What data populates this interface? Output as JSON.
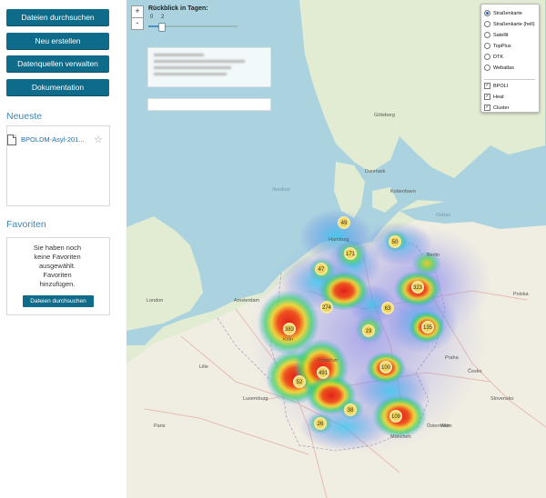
{
  "sidebar": {
    "buttons": [
      "Dateien durchsuchen",
      "Neu erstellen",
      "Datenquellen verwalten",
      "Dokumentation"
    ],
    "recent": {
      "title": "Neueste",
      "items": [
        {
          "label": "BPOLDM-Asyl-201..."
        }
      ]
    },
    "favorites": {
      "title": "Favoriten",
      "empty_text": "Sie haben noch keine Favoriten ausgewählt. Favoriten hinzufügen.",
      "button": "Dateien durchsuchen"
    }
  },
  "map": {
    "zoom_in": "+",
    "zoom_out": "-",
    "slider": {
      "title": "Rückblick in Tagen:",
      "min_label": "0",
      "max_label": "2",
      "value_fraction": 0.14
    },
    "layers": {
      "base": [
        {
          "label": "Straßenkarte",
          "selected": true
        },
        {
          "label": "Straßenkarte (hell)",
          "selected": false
        },
        {
          "label": "Satellit",
          "selected": false
        },
        {
          "label": "TopPlus",
          "selected": false
        },
        {
          "label": "DTK",
          "selected": false
        },
        {
          "label": "Webatlas",
          "selected": false
        }
      ],
      "overlays": [
        {
          "label": "BPOLI",
          "checked": true
        },
        {
          "label": "Heat",
          "checked": true
        },
        {
          "label": "Cluster",
          "checked": true
        }
      ]
    },
    "clusters": [
      "49",
      "50",
      "171",
      "47",
      "323",
      "274",
      "63",
      "19",
      "135",
      "383",
      "491",
      "52",
      "100",
      "26",
      "38",
      "109"
    ],
    "places": [
      "Hamburg",
      "Berlin",
      "Köln",
      "Frankfurt",
      "München",
      "London",
      "Amsterdam",
      "Kobenhavn",
      "Göteborg",
      "Praha",
      "Wien",
      "Luxemburg",
      "Polska",
      "Česko",
      "Slovensko",
      "Österreich",
      "Danmark",
      "Lille",
      "Paris"
    ],
    "water_labels": [
      "Nordsee",
      "Ostsee"
    ]
  }
}
